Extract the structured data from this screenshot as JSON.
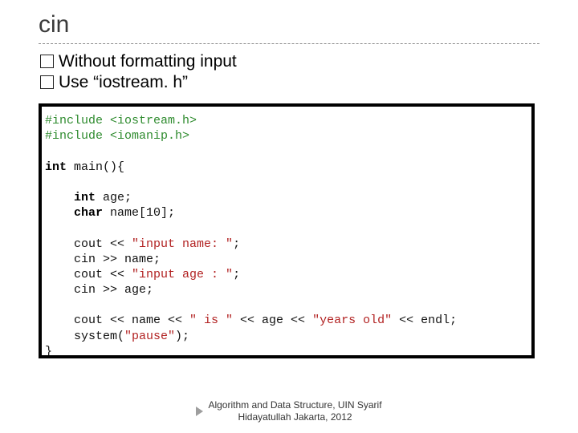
{
  "title": "cin",
  "bullets": [
    {
      "text": "Without formatting input"
    },
    {
      "text": "Use “iostream. h”"
    }
  ],
  "code": {
    "include1": "#include <iostream.h>",
    "include2": "#include <iomanip.h>",
    "int_kw": "int",
    "main_sig": " main(){",
    "int_kw2": "int",
    "age_decl": " age;",
    "char_kw": "char",
    "name_decl": " name[10];",
    "cout1a": "    cout << ",
    "str1": "\"input name: \"",
    "cout1b": ";",
    "cin1": "    cin >> name;",
    "cout2a": "    cout << ",
    "str2": "\"input age : \"",
    "cout2b": ";",
    "cin2": "    cin >> age;",
    "cout3a": "    cout << name << ",
    "str3a": "\" is \"",
    "cout3b": " << age << ",
    "str3b": "\"years old\"",
    "cout3c": " << endl;",
    "sys_a": "    system(",
    "sys_str": "\"pause\"",
    "sys_b": ");",
    "close": "}"
  },
  "footer": {
    "line1": "Algorithm and Data Structure, UIN Syarif",
    "line2": "Hidayatullah Jakarta, 2012"
  }
}
